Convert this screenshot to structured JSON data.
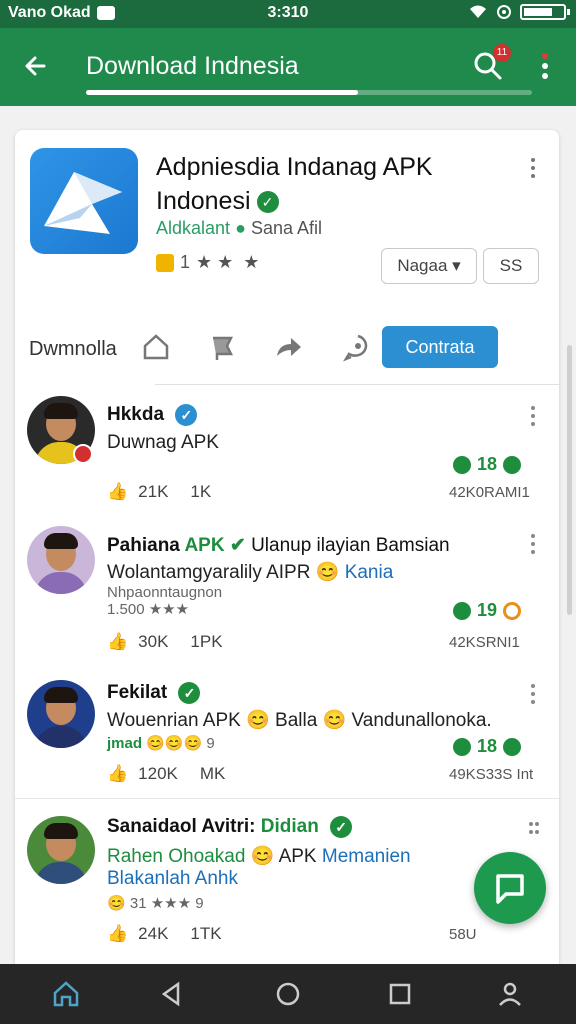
{
  "status_bar": {
    "carrier": "Vano Okad",
    "time": "3:310"
  },
  "app_bar": {
    "title": "Download Indnesia",
    "notification_count": "11",
    "progress": 0.61
  },
  "app": {
    "name": "Adpniesdia Indanag APK Indonesi",
    "developer": "Aldkalant",
    "subtitle": "Sana Afil",
    "rating_value": "1",
    "dropdown_label": "Nagaa",
    "secondary_button_label": "SS"
  },
  "actions": {
    "label": "Dwmnolla",
    "cta_label": "Contrata"
  },
  "posts": [
    {
      "name": "Hkkda",
      "text": "Duwnag APK",
      "likes": "21K",
      "comments": "1K",
      "score": "18",
      "time": "42K0RAMI1"
    },
    {
      "name": "Pahiana",
      "name_tag": "APK",
      "text_after": "Ulanup ilayian Bamsian",
      "line2": "Wolantamgyaralily AIPR",
      "line2_blue": "Kania",
      "meta": "Nhpaonntaugnon",
      "meta2": "1.500",
      "likes": "30K",
      "comments": "1PK",
      "score": "19",
      "time": "42KSRNI1"
    },
    {
      "name": "Fekilat",
      "text": "Wouenrian APK",
      "text_mid": "Balla",
      "text_end": "Vandunallonoka.",
      "meta": "jmad",
      "meta2": "9",
      "likes": "120K",
      "comments": "MK",
      "score": "18",
      "time": "49KS33S Int"
    },
    {
      "name": "Sanaidaol Avitri:",
      "name_tag": "Didian",
      "line1_green": "Rahen Ohoakad",
      "line1_rest": "APK",
      "line1_blue": "Memanien",
      "line2": "Blakanlah Anhk",
      "meta2": "31",
      "meta3": "9",
      "likes": "24K",
      "comments": "1TK",
      "time": "58U"
    }
  ],
  "colors": {
    "primary": "#208a4c",
    "accent": "#2c8fd2",
    "fab": "#1e9a4f"
  }
}
